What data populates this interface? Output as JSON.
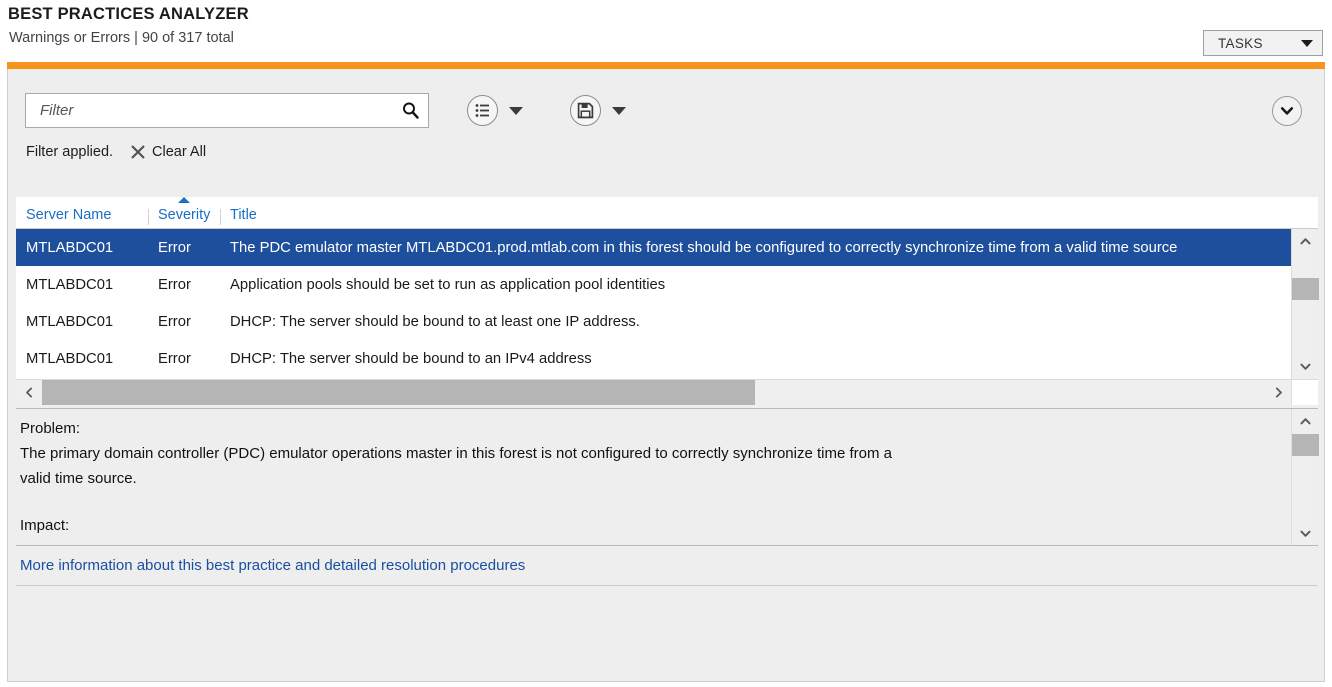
{
  "header": {
    "title": "BEST PRACTICES ANALYZER",
    "subtitle": "Warnings or Errors | 90 of 317 total",
    "tasks_label": "TASKS",
    "tasks_caret_icon": "caret-down-icon",
    "accent_color": "#f7941e"
  },
  "toolbar": {
    "filter_placeholder": "Filter",
    "filter_value": "",
    "search_icon": "magnifier-icon",
    "view_button_icon": "list-view-icon",
    "view_caret_icon": "caret-down-icon",
    "save_button_icon": "save-disk-icon",
    "save_caret_icon": "caret-down-icon",
    "expander_icon": "chevron-down-circle-icon"
  },
  "filter_status": {
    "message": "Filter applied.",
    "clear_icon": "close-x-icon",
    "clear_label": "Clear All"
  },
  "grid": {
    "columns": [
      {
        "label": "Server Name",
        "sorted": false
      },
      {
        "label": "Severity",
        "sorted": true,
        "sort_icon": "sort-ascending-icon"
      },
      {
        "label": "Title",
        "sorted": false
      }
    ],
    "rows": [
      {
        "server": "MTLABDC01",
        "severity": "Error",
        "title": "The PDC emulator master MTLABDC01.prod.mtlab.com in this forest should be configured to correctly synchronize time from a valid time source",
        "selected": true
      },
      {
        "server": "MTLABDC01",
        "severity": "Error",
        "title": "Application pools should be set to run as application pool identities",
        "selected": false
      },
      {
        "server": "MTLABDC01",
        "severity": "Error",
        "title": "DHCP: The server should be bound to at least one IP address.",
        "selected": false
      },
      {
        "server": "MTLABDC01",
        "severity": "Error",
        "title": "DHCP: The server should be bound to an IPv4 address",
        "selected": false
      }
    ],
    "selection_color": "#1e4f9c",
    "header_link_color": "#1a6fc4",
    "scroll_up_icon": "chevron-up-icon",
    "scroll_down_icon": "chevron-down-icon",
    "scroll_left_icon": "chevron-left-icon",
    "scroll_right_icon": "chevron-right-icon"
  },
  "details": {
    "problem_label": "Problem:",
    "problem_line1": "The primary domain controller (PDC) emulator operations master in this forest is not configured to correctly synchronize time from a",
    "problem_line2": "valid time source.",
    "impact_label": "Impact:",
    "scroll_up_icon": "chevron-up-icon",
    "scroll_down_icon": "chevron-down-icon"
  },
  "footer": {
    "more_info_link": "More information about this best practice and detailed resolution procedures",
    "link_color": "#1a4fa0"
  }
}
